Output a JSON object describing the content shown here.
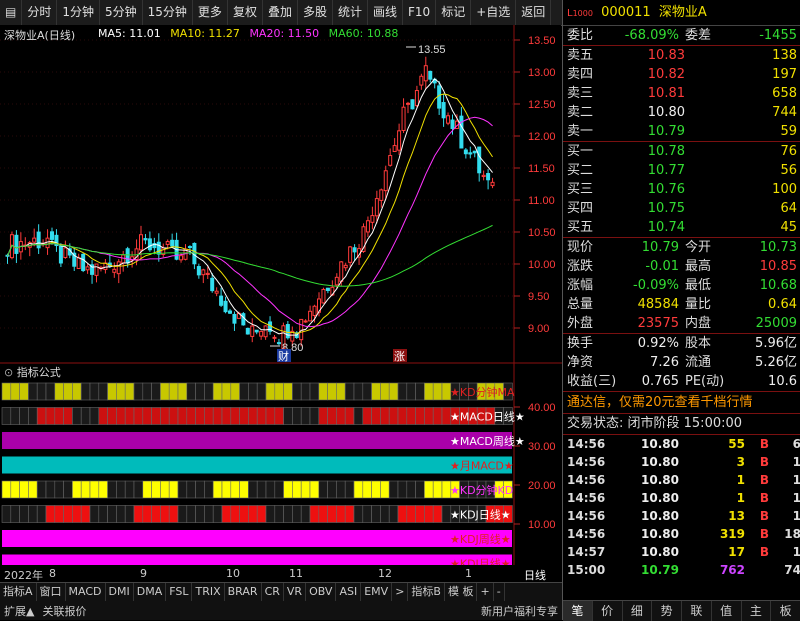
{
  "toolbar": {
    "items": [
      "分时",
      "1分钟",
      "5分钟",
      "15分钟",
      "更多",
      "复权",
      "叠加",
      "多股",
      "统计",
      "画线",
      "F10",
      "标记",
      "+自选",
      "返回"
    ]
  },
  "chart": {
    "title": "深物业A(日线)",
    "ma": [
      {
        "label": "MA5: 11.01",
        "color": "#ffffff"
      },
      {
        "label": "MA10: 11.27",
        "color": "#f0e000"
      },
      {
        "label": "MA20: 11.50",
        "color": "#ff33ff"
      },
      {
        "label": "MA60: 10.88",
        "color": "#33dd33"
      }
    ],
    "high_label": "13.55",
    "low_label": "8.80",
    "marker_cai": "财",
    "marker_zhang": "涨",
    "price_ticks": [
      "13.50",
      "13.00",
      "12.50",
      "12.00",
      "11.50",
      "11.00",
      "10.50",
      "10.00",
      "9.50",
      "9.00"
    ],
    "indicator_header": "指标公式",
    "indicator_ticks": [
      "40.00",
      "30.00",
      "20.00",
      "10.00"
    ],
    "bands": [
      {
        "label": "★KD分钟MA",
        "color": "#e02020"
      },
      {
        "label": "★MACD日线★",
        "color": "#ffffff"
      },
      {
        "label": "★MACD周线★",
        "color": "#ffffff"
      },
      {
        "label": "★月MACD★",
        "color": "#e02020"
      },
      {
        "label": "★KD分钟KD",
        "color": "#ff33ff"
      },
      {
        "label": "★KDJ日线★",
        "color": "#ffffff"
      },
      {
        "label": "★KDJ周线★",
        "color": "#e02020"
      },
      {
        "label": "★KDJ月线★",
        "color": "#e02020"
      }
    ],
    "dates": [
      "2022年",
      "8",
      "9",
      "10",
      "11",
      "12",
      "1"
    ],
    "period": "日线"
  },
  "bottom_tabs": [
    "指标A",
    "窗口",
    "MACD",
    "DMI",
    "DMA",
    "FSL",
    "TRIX",
    "BRAR",
    "CR",
    "VR",
    "OBV",
    "ASI",
    "EMV",
    ">",
    "指标B",
    "模 板",
    "+",
    "-"
  ],
  "status_bar": [
    "扩展▲",
    "关联报价",
    "新用户福利专享"
  ],
  "quote": {
    "code": "000011",
    "name": "深物业A",
    "weibi_label": "委比",
    "weibi": "-68.09%",
    "weicha_label": "委差",
    "weicha": "-1455",
    "asks": [
      {
        "label": "卖五",
        "price": "10.83",
        "vol": "138"
      },
      {
        "label": "卖四",
        "price": "10.82",
        "vol": "197"
      },
      {
        "label": "卖三",
        "price": "10.81",
        "vol": "658"
      },
      {
        "label": "卖二",
        "price": "10.80",
        "vol": "744"
      },
      {
        "label": "卖一",
        "price": "10.79",
        "vol": "59"
      }
    ],
    "bids": [
      {
        "label": "买一",
        "price": "10.78",
        "vol": "76"
      },
      {
        "label": "买二",
        "price": "10.77",
        "vol": "56"
      },
      {
        "label": "买三",
        "price": "10.76",
        "vol": "100"
      },
      {
        "label": "买四",
        "price": "10.75",
        "vol": "64"
      },
      {
        "label": "买五",
        "price": "10.74",
        "vol": "45"
      }
    ],
    "stats": [
      {
        "l1": "现价",
        "v1": "10.79",
        "c1": "green",
        "l2": "今开",
        "v2": "10.73",
        "c2": "green"
      },
      {
        "l1": "涨跌",
        "v1": "-0.01",
        "c1": "green",
        "l2": "最高",
        "v2": "10.85",
        "c2": "red"
      },
      {
        "l1": "涨幅",
        "v1": "-0.09%",
        "c1": "green",
        "l2": "最低",
        "v2": "10.68",
        "c2": "green"
      },
      {
        "l1": "总量",
        "v1": "48584",
        "c1": "yellow",
        "l2": "量比",
        "v2": "0.64",
        "c2": "yellow"
      },
      {
        "l1": "外盘",
        "v1": "23575",
        "c1": "red",
        "l2": "内盘",
        "v2": "25009",
        "c2": "green"
      }
    ],
    "stats2": [
      {
        "l1": "换手",
        "v1": "0.92%",
        "l2": "股本",
        "v2": "5.96亿"
      },
      {
        "l1": "净资",
        "v1": "7.26",
        "l2": "流通",
        "v2": "5.26亿"
      },
      {
        "l1": "收益(三)",
        "v1": "0.765",
        "l2": "PE(动)",
        "v2": "10.6"
      }
    ],
    "promo": "通达信，仅需20元查看千档行情",
    "trade_status": "交易状态: 闭市阶段 15:00:00",
    "ticks": [
      {
        "t": "14:56",
        "p": "10.80",
        "v": "55",
        "d": "B",
        "e": "6"
      },
      {
        "t": "14:56",
        "p": "10.80",
        "v": "3",
        "d": "B",
        "e": "1"
      },
      {
        "t": "14:56",
        "p": "10.80",
        "v": "1",
        "d": "B",
        "e": "1"
      },
      {
        "t": "14:56",
        "p": "10.80",
        "v": "1",
        "d": "B",
        "e": "1"
      },
      {
        "t": "14:56",
        "p": "10.80",
        "v": "13",
        "d": "B",
        "e": "1"
      },
      {
        "t": "14:56",
        "p": "10.80",
        "v": "319",
        "d": "B",
        "e": "18"
      },
      {
        "t": "14:57",
        "p": "10.80",
        "v": "17",
        "d": "B",
        "e": "1"
      },
      {
        "t": "15:00",
        "p": "10.79",
        "v": "762",
        "d": "",
        "e": "74"
      }
    ],
    "tabs": [
      "笔",
      "价",
      "细",
      "势",
      "联",
      "值",
      "主",
      "板"
    ]
  }
}
